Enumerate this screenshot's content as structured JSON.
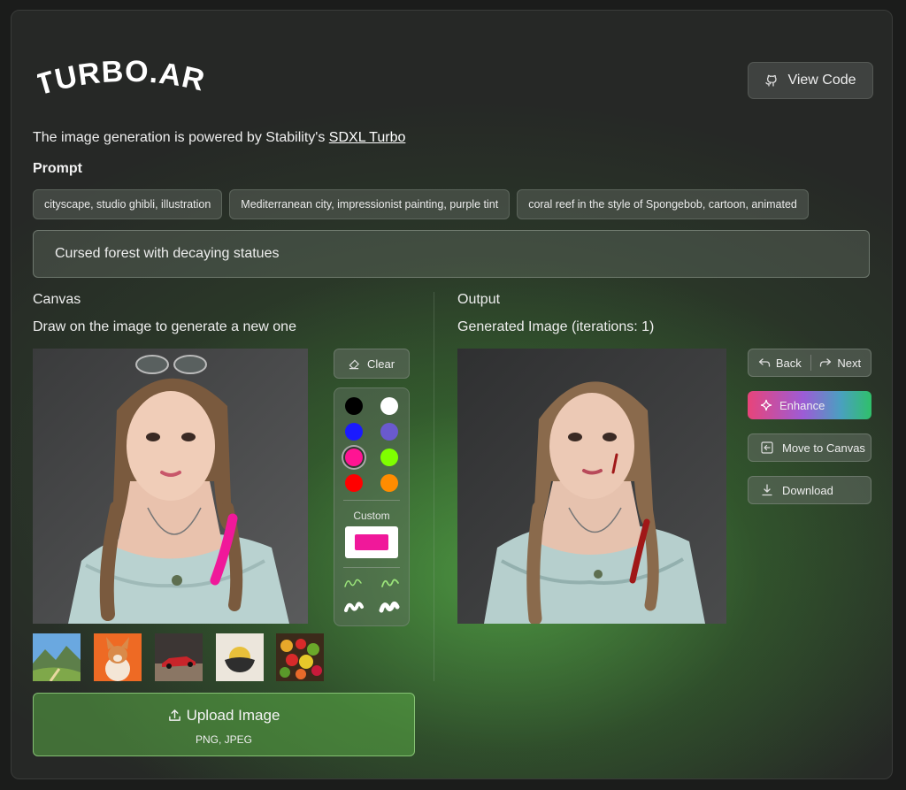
{
  "header": {
    "logo_text": "TURBO.ART",
    "view_code_label": "View Code",
    "view_code_icon": "github-icon"
  },
  "powered": {
    "prefix": "The image generation is powered by Stability's ",
    "link_text": "SDXL Turbo"
  },
  "prompt": {
    "label": "Prompt",
    "suggestions": [
      "cityscape, studio ghibli, illustration",
      "Mediterranean city, impressionist painting, purple tint",
      "coral reef in the style of Spongebob, cartoon, animated"
    ],
    "value": "Cursed forest with decaying statues"
  },
  "canvas": {
    "title": "Canvas",
    "subtitle": "Draw on the image to generate a new one",
    "clear_label": "Clear",
    "custom_label": "Custom",
    "colors": [
      "#000000",
      "#ffffff",
      "#1a1aff",
      "#6a5acd",
      "#ff1493",
      "#7fff00",
      "#ff0000",
      "#ff8c00"
    ],
    "selected_color": "#ff1493",
    "custom_color": "#f0189a",
    "brush_color": "#f0189a",
    "thumbnails": [
      "mountain-landscape",
      "corgi-dog",
      "red-sports-car",
      "abstract-sun",
      "fruit-bowl"
    ]
  },
  "upload": {
    "label": "Upload Image",
    "formats": "PNG, JPEG"
  },
  "output": {
    "title": "Output",
    "subtitle": "Generated Image (iterations: 1)",
    "back_label": "Back",
    "next_label": "Next",
    "enhance_label": "Enhance",
    "move_label": "Move to Canvas",
    "download_label": "Download"
  }
}
